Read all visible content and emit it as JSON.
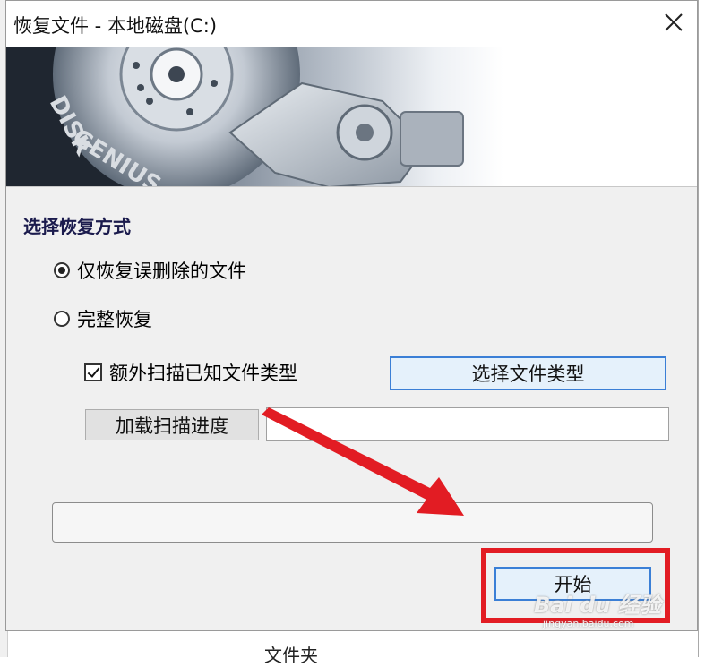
{
  "window": {
    "title": "恢复文件 - 本地磁盘(C:)",
    "close_icon": "close-icon"
  },
  "banner": {
    "brand": "DISK GENIUS"
  },
  "recovery": {
    "section_title": "选择恢复方式",
    "options": [
      {
        "label": "仅恢复误删除的文件",
        "selected": true
      },
      {
        "label": "完整恢复",
        "selected": false
      }
    ],
    "scan_known_types": {
      "label": "额外扫描已知文件类型",
      "checked": true
    },
    "select_types_button": "选择文件类型",
    "load_progress_button": "加载扫描进度",
    "load_progress_path": "",
    "start_button": "开始"
  },
  "annotation": {
    "color": "#e21c23"
  },
  "watermark": {
    "text": "Bai du 经验",
    "sub": "jingyan.baidu.com"
  },
  "background": {
    "partial_text": "文件夹"
  }
}
